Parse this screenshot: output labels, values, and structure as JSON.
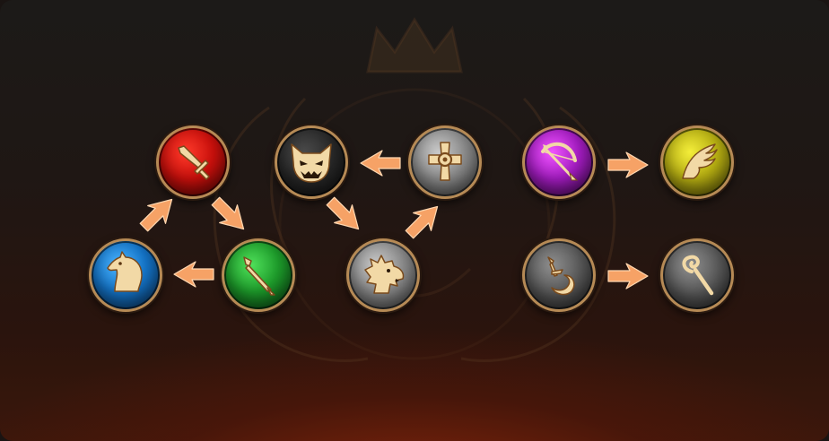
{
  "theme": {
    "accent": "#f0a060",
    "gold": "#e9c98a",
    "arrow": "#f6a266"
  },
  "nodes": [
    {
      "id": "warrior",
      "icon": "sword-icon",
      "color": "#d0120d"
    },
    {
      "id": "knight",
      "icon": "horse-head-icon",
      "color": "#1473c6"
    },
    {
      "id": "lancer",
      "icon": "spear-icon",
      "color": "#1d9a2a"
    },
    {
      "id": "demon",
      "icon": "demon-mask-icon",
      "color": "#262626"
    },
    {
      "id": "priest",
      "icon": "celtic-cross-icon",
      "color": "#8a8a8a"
    },
    {
      "id": "beast",
      "icon": "dragon-head-icon",
      "color": "#8a8a8a"
    },
    {
      "id": "archer",
      "icon": "bow-icon",
      "color": "#a21cbf"
    },
    {
      "id": "flyer",
      "icon": "wing-icon",
      "color": "#b5ad12"
    },
    {
      "id": "assassin",
      "icon": "moon-dagger-icon",
      "color": "#555555"
    },
    {
      "id": "mage",
      "icon": "staff-icon",
      "color": "#555555"
    }
  ],
  "arrows": [
    {
      "from": "knight",
      "to": "warrior"
    },
    {
      "from": "warrior",
      "to": "lancer"
    },
    {
      "from": "lancer",
      "to": "knight"
    },
    {
      "from": "priest",
      "to": "demon"
    },
    {
      "from": "demon",
      "to": "beast"
    },
    {
      "from": "beast",
      "to": "priest"
    },
    {
      "from": "archer",
      "to": "flyer"
    },
    {
      "from": "assassin",
      "to": "mage"
    }
  ]
}
